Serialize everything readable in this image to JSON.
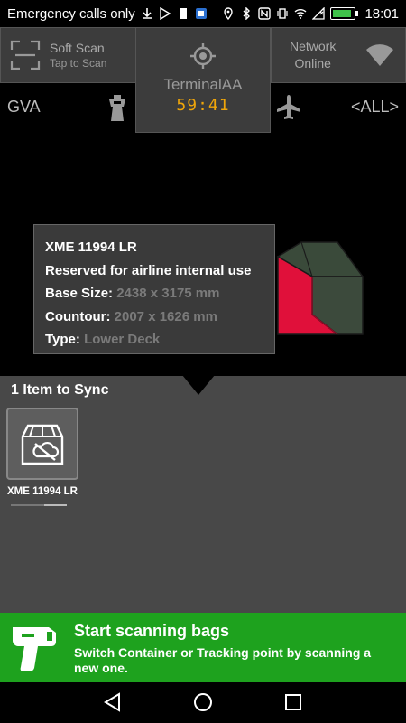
{
  "status_bar": {
    "carrier": "Emergency calls only",
    "time": "18:01",
    "battery_level": 0.95
  },
  "header": {
    "soft_scan": {
      "title": "Soft Scan",
      "subtitle": "Tap to Scan",
      "icon": "scan-frame-icon"
    },
    "terminal": {
      "name": "TerminalAA",
      "timer": "59:41",
      "icon": "crosshair-icon"
    },
    "network": {
      "line1": "Network",
      "line2": "Online",
      "icon": "wifi-icon"
    }
  },
  "location_row": {
    "station": "GVA",
    "tower_icon": "control-tower-icon",
    "plane_icon": "airplane-icon",
    "filter": "<ALL>"
  },
  "container_card": {
    "id": "XME 11994 LR",
    "note": "Reserved for airline internal use",
    "base_size_label": "Base Size:",
    "base_size_value": "2438 x 3175 mm",
    "contour_label": "Countour:",
    "contour_value": "2007  x 1626  mm",
    "type_label": "Type:",
    "type_value": "Lower Deck"
  },
  "sync_panel": {
    "title": "1 Item to Sync",
    "items": [
      {
        "label": "XME 11994 LR",
        "icon": "box-cloud-off-icon",
        "progress": 0.4
      }
    ]
  },
  "banner": {
    "title": "Start scanning bags",
    "subtitle": "Switch Container or Tracking point by scanning a new one.",
    "icon": "scanner-gun-icon"
  },
  "nav": {
    "back": "back-icon",
    "home": "home-icon",
    "recents": "recents-icon"
  },
  "colors": {
    "accent_green": "#1ea21e",
    "timer_orange": "#f0a60a",
    "uld_red": "#e0103a"
  }
}
